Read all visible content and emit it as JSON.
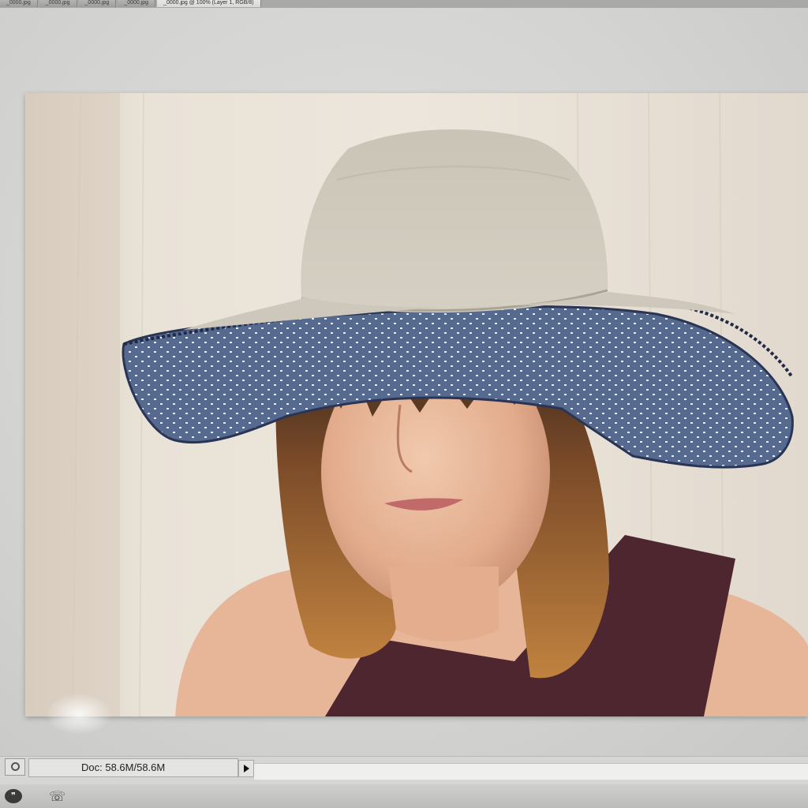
{
  "window": {
    "tabs": [
      {
        "label": "_0000.jpg",
        "active": false
      },
      {
        "label": "_0000.jpg",
        "active": false
      },
      {
        "label": "_0000.jpg",
        "active": false
      },
      {
        "label": "_0000.jpg",
        "active": false
      },
      {
        "label": "_0000.jpg @ 100% (Layer 1, RGB/8)",
        "active": true
      }
    ]
  },
  "canvas": {
    "image_subject": "photo-woman-in-wide-brim-hat"
  },
  "status_bar": {
    "doc_size": "Doc: 58.6M/58.6M"
  },
  "dock": {
    "icons": [
      "chat-icon",
      "phone-icon"
    ]
  },
  "colors": {
    "hat_crown": "#cdc8bb",
    "brim_underside": "#5a6c93",
    "hair": "#a66a35",
    "top": "#4e2630",
    "background_wall": "#e8e1d6"
  }
}
